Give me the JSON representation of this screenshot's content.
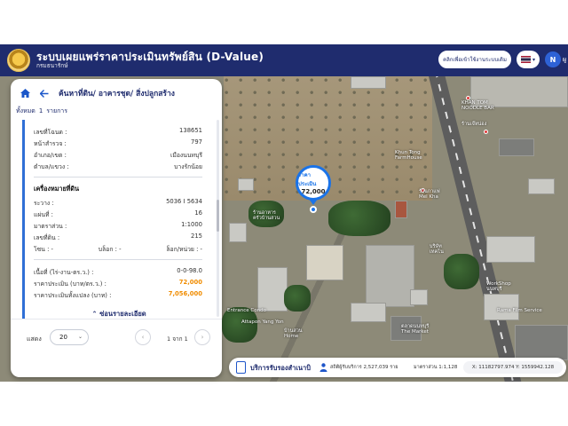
{
  "header": {
    "title": "ระบบเผยแพร่ราคาประเมินทรัพย์สิน (D-Value)",
    "subtitle": "กรมธนารักษ์",
    "manual_label": "คลิกเพื่อเข้าใช้งานระบบเดิม",
    "avatar_letter": "N",
    "user_text": "ผู"
  },
  "panel": {
    "title": "ค้นหาที่ดิน/ อาคารชุด/ สิ่งปลูกสร้าง",
    "count_label": "ทั้งหมด",
    "count_value": "1",
    "count_unit": "รายการ",
    "rows_top": [
      {
        "label": "เลขที่โฉนด :",
        "value": "138651"
      },
      {
        "label": "หน้าสำรวจ :",
        "value": "797"
      },
      {
        "label": "อำเภอ/เขต :",
        "value": "เมืองนนทบุรี"
      },
      {
        "label": "ตำบล/แขวง :",
        "value": "บางรักน้อย"
      }
    ],
    "section_title": "เครื่องหมายที่ดิน",
    "rows_mid": [
      {
        "label": "ระวาง :",
        "value": "5036 I 5634"
      },
      {
        "label": "แผ่นที่ :",
        "value": "16"
      },
      {
        "label": "มาตราส่วน :",
        "value": "1:1000"
      },
      {
        "label": "เลขที่ดิน :",
        "value": "215"
      }
    ],
    "zone_row": {
      "a": "โซน :",
      "a_val": "-",
      "b": "บล็อก :",
      "b_val": "-",
      "c": "ล็อก/หน่วย :",
      "c_val": "-"
    },
    "rows_bottom": [
      {
        "label": "เนื้อที่ (ไร่-งาน-ตร.ว.) :",
        "value": "0-0-98.0",
        "highlight": false
      },
      {
        "label": "ราคาประเมิน (บาท/ตร.ว.) :",
        "value": "72,000",
        "highlight": true
      },
      {
        "label": "ราคาประเมินทั้งแปลง (บาท) :",
        "value": "7,056,000",
        "highlight": true
      }
    ],
    "hide_detail": "ซ่อนรายละเอียด"
  },
  "pager": {
    "show_label": "แสดง",
    "page_size": "20",
    "page_text": "1 จาก 1"
  },
  "marker": {
    "label": "ราคาประเมิน",
    "value": "72,000"
  },
  "map_labels": [
    "KHAN TOM\nNOODLE BAR",
    "ร้านเจ๊หน่อง",
    "Khun Tong\nFarmHouse",
    "ร้านกาแฟ\nMei Kha",
    "ร้านอาหาร\nครัวบ้านสวน",
    "บริษัท\nเทคโน",
    "WorkShop\nนนทบุรี",
    "Rama Film Service",
    "ตลาดนนทบุรี\nThe Market",
    "Attapon Yang Yon",
    "Entrance Condo",
    "บ้านสวน\nHome"
  ],
  "infobar": {
    "service_text": "บริการรับรองสำเนาบิ",
    "stat_visitors": "สถิติผู้รับบริการ 2,527,039 ราย",
    "stat_scale": "มาตราส่วน 1:1,128",
    "coords": "X: 11182797.974  Y: 1559942.128"
  },
  "colors": {
    "header_bg": "#1f2c6e",
    "accent": "#1a73e8",
    "price_orange": "#f08c00"
  }
}
